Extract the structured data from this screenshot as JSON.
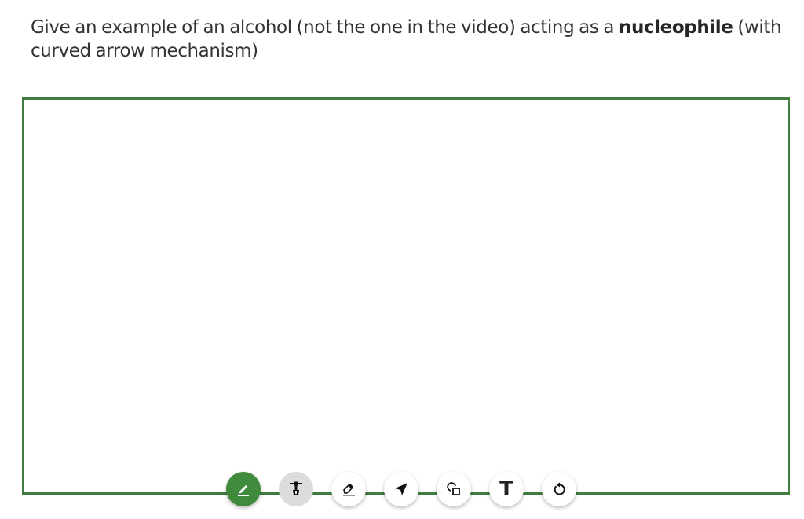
{
  "question": {
    "prefix": "Give an example of an alcohol (not the one in the video) acting as a ",
    "emphasis": "nucleophile",
    "suffix": " (with curved arrow mechanism)"
  },
  "toolbar": {
    "tools": [
      {
        "name": "pen",
        "icon": "pencil-icon",
        "state": "active"
      },
      {
        "name": "highlighter",
        "icon": "marker-icon",
        "state": "disabled"
      },
      {
        "name": "eraser",
        "icon": "eraser-icon",
        "state": "normal"
      },
      {
        "name": "select",
        "icon": "pointer-arrow-icon",
        "state": "normal"
      },
      {
        "name": "shapes",
        "icon": "shapes-icon",
        "state": "normal"
      },
      {
        "name": "text",
        "icon": "text-icon",
        "label": "T",
        "state": "normal"
      },
      {
        "name": "undo",
        "icon": "undo-icon",
        "state": "normal"
      }
    ]
  },
  "colors": {
    "accent": "#3f8a3d",
    "border": "#3f7e3e",
    "text": "#333333"
  }
}
